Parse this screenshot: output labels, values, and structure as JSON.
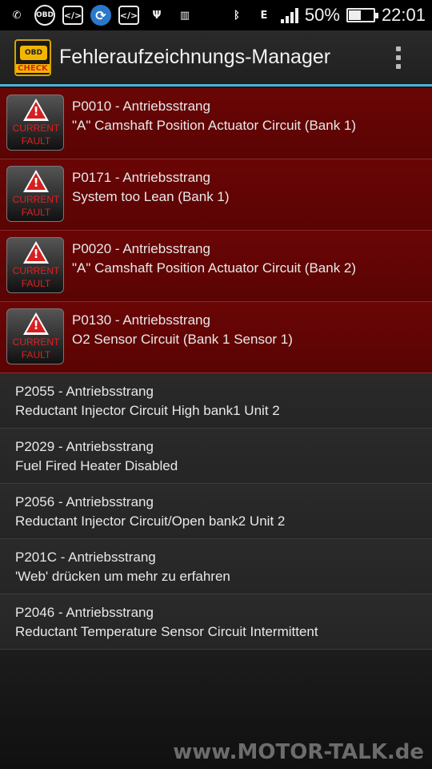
{
  "status_bar": {
    "battery_percent": "50%",
    "battery_level": 0.5,
    "time": "22:01",
    "icons": [
      "whatsapp-icon",
      "obd-icon",
      "code-icon",
      "sync-icon",
      "code-icon",
      "usb-icon",
      "barcode-icon",
      "bluetooth-icon",
      "data-e-icon",
      "signal-icon",
      "battery-charging-icon"
    ],
    "obd_label": "OBD",
    "data_label": "E"
  },
  "app": {
    "title": "Fehleraufzeichnungs-Manager",
    "logo_top": "OBD",
    "logo_bottom": "CHECK"
  },
  "badge": {
    "line1": "CURRENT",
    "line2": "FAULT"
  },
  "current_faults": [
    {
      "code": "P0010 - Antriebsstrang",
      "desc": "\"A\" Camshaft Position Actuator Circuit (Bank 1)"
    },
    {
      "code": "P0171 - Antriebsstrang",
      "desc": "System too Lean (Bank 1)"
    },
    {
      "code": "P0020 - Antriebsstrang",
      "desc": "\"A\" Camshaft Position Actuator Circuit (Bank 2)"
    },
    {
      "code": "P0130 - Antriebsstrang",
      "desc": "O2 Sensor Circuit (Bank 1 Sensor 1)"
    }
  ],
  "history_faults": [
    {
      "code": "P2055 - Antriebsstrang",
      "desc": "Reductant Injector Circuit High bank1 Unit 2"
    },
    {
      "code": "P2029 - Antriebsstrang",
      "desc": "Fuel Fired Heater Disabled"
    },
    {
      "code": "P2056 - Antriebsstrang",
      "desc": "Reductant Injector Circuit/Open bank2 Unit 2"
    },
    {
      "code": "P201C - Antriebsstrang",
      "desc": "'Web' drücken um mehr zu erfahren"
    },
    {
      "code": "P2046 - Antriebsstrang",
      "desc": "Reductant Temperature Sensor Circuit Intermittent"
    }
  ],
  "watermark": "www.MOTOR-TALK.de",
  "colors": {
    "accent": "#4ab3d8",
    "current_row": "#640505",
    "history_row": "#282828"
  }
}
